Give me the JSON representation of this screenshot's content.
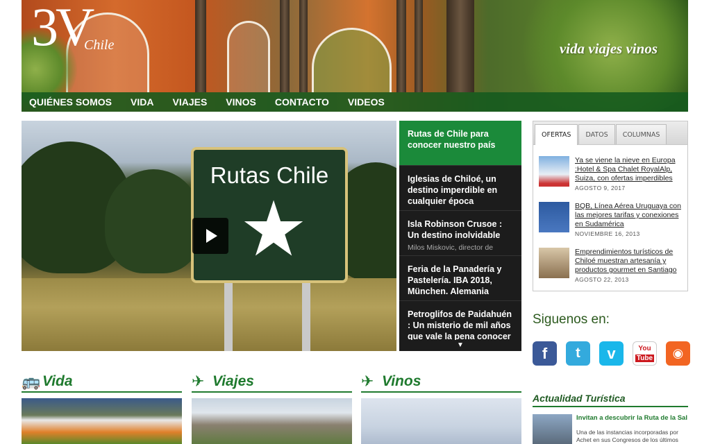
{
  "header": {
    "logo_main": "3V",
    "logo_sub": "Chile",
    "tagline": "vida viajes vinos",
    "nav": [
      "QUIÉNES SOMOS",
      "VIDA",
      "VIAJES",
      "VINOS",
      "CONTACTO",
      "VIDEOS"
    ]
  },
  "video": {
    "sign_text": "Rutas Chile"
  },
  "slider": {
    "items": [
      {
        "title": "Rutas de Chile para conocer nuestro país",
        "sub": ""
      },
      {
        "title": "Iglesias de Chiloé, un destino imperdible en cualquier época",
        "sub": ""
      },
      {
        "title": "Isla Robinson Crusoe : Un destino inolvidable",
        "sub": "Milos Miskovic, director de"
      },
      {
        "title": "Feria de la Panadería y Pastelería. IBA 2018, München. Alemania",
        "sub": ""
      },
      {
        "title": "Petroglifos de Paidahuén : Un misterio de mil años que vale la pena conocer",
        "sub": ""
      }
    ],
    "more_arrow": "▼"
  },
  "tabs": {
    "labels": [
      "OFERTAS",
      "DATOS",
      "COLUMNAS"
    ],
    "news": [
      {
        "title": "Ya se viene la nieve en Europa :Hotel & Spa Chalet RoyalAlp, Suiza, con ofertas imperdibles",
        "date": "AGOSTO 9, 2017"
      },
      {
        "title": "BQB, Línea Aérea Uruguaya con las mejores tarifas y conexiones en Sudamérica",
        "date": "NOVIEMBRE 16, 2013"
      },
      {
        "title": "Emprendimientos turísticos de Chiloé muestran artesanía y productos gourmet en Santiago",
        "date": "AGOSTO 22, 2013"
      }
    ]
  },
  "social": {
    "heading": "Siguenos en:",
    "icons": [
      "facebook-icon",
      "twitter-icon",
      "vimeo-icon",
      "youtube-icon",
      "rss-icon"
    ]
  },
  "sections": [
    {
      "title": "Vida",
      "icon": "bus-icon"
    },
    {
      "title": "Viajes",
      "icon": "airplane-icon"
    },
    {
      "title": "Vinos",
      "icon": "airplane-icon"
    }
  ],
  "actualidad": {
    "heading": "Actualidad Turística",
    "item_title": "Invitan a descubrir la Ruta de la Sal",
    "item_body": "Una de las instancias incorporadas por Achet en sus Congresos de los últimos años"
  },
  "colors": {
    "brand_green": "#1f7a2e",
    "nav_bg": "#145a1e",
    "active_slide": "#1b8a3a"
  }
}
